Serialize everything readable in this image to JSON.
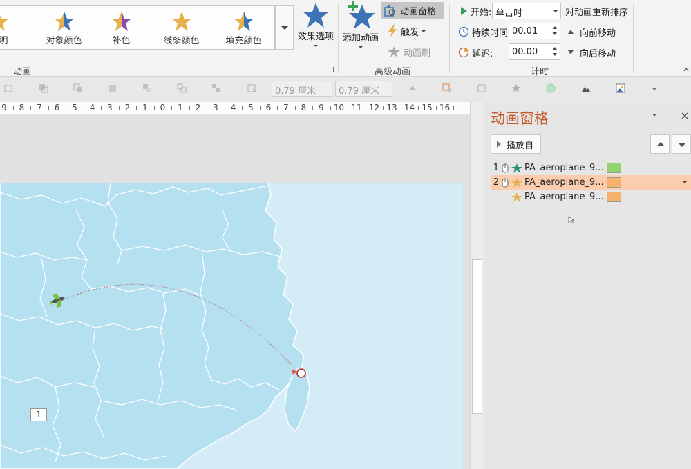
{
  "ribbon": {
    "gallery_items": [
      {
        "label": "明"
      },
      {
        "label": "对象颜色"
      },
      {
        "label": "补色"
      },
      {
        "label": "线条颜色"
      },
      {
        "label": "填充颜色"
      }
    ],
    "effects_options_label": "效果选项",
    "animation_group_label": "动画",
    "add_animation_label": "添加动画",
    "animation_pane_button_label": "动画窗格",
    "trigger_label": "触发",
    "animation_painter_label": "动画刷",
    "advanced_group_label": "高级动画",
    "start_label": "开始:",
    "start_value": "单击时",
    "duration_label": "持续时间:",
    "duration_value": "00.01",
    "delay_label": "延迟:",
    "delay_value": "00.00",
    "reorder_label": "对动画重新排序",
    "move_earlier_label": "向前移动",
    "move_later_label": "向后移动",
    "timing_group_label": "计时"
  },
  "toolbar": {
    "height_value": "0.79 厘米",
    "width_value": "0.79 厘米"
  },
  "ruler": {
    "labels": [
      "9",
      "8",
      "7",
      "6",
      "5",
      "4",
      "3",
      "2",
      "1",
      "0",
      "1",
      "2",
      "3",
      "4",
      "5",
      "6",
      "7",
      "8",
      "9",
      "10",
      "11",
      "12",
      "13",
      "14",
      "15",
      "16"
    ]
  },
  "slide": {
    "sequence_tag": "1"
  },
  "pane": {
    "title": "动画窗格",
    "play_label": "播放自",
    "items": [
      {
        "number": "1",
        "name": "PA_aeroplane_9...",
        "icon": "spin-star-icon",
        "swatch_color": "#92d36e"
      },
      {
        "number": "2",
        "name": "PA_aeroplane_9...",
        "icon": "star-icon",
        "swatch_color": "#f6b26b",
        "selected": true
      },
      {
        "number": "",
        "name": "PA_aeroplane_9...",
        "icon": "star-icon",
        "swatch_color": "#f6b26b"
      }
    ]
  },
  "colors": {
    "accent": "#c55a2b",
    "star_blue": "#3d74b5",
    "star_gold": "#e8b04b",
    "selection": "#fcccae",
    "sea": "#d3ecf6",
    "land": "#b5e0f0"
  }
}
